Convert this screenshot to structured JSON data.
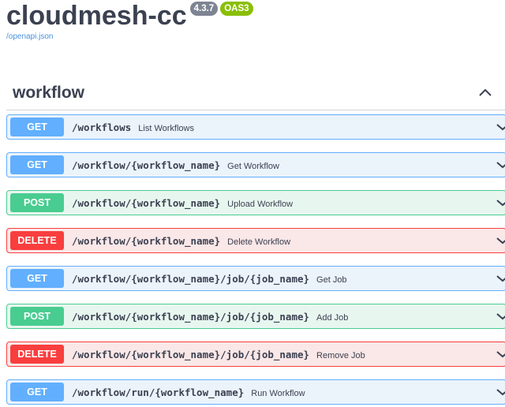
{
  "header": {
    "title": "cloudmesh-cc",
    "version_badge": "4.3.7",
    "oas_badge": "OAS3",
    "spec_link": "/openapi.json"
  },
  "colors": {
    "get": "#61affe",
    "post": "#49cc90",
    "delete": "#f93e3e",
    "version_badge": "#7d8492",
    "oas_badge": "#89bf04",
    "link": "#4990e2"
  },
  "tag": {
    "name": "workflow",
    "toggle_icon": "chevron-up-icon"
  },
  "operations": [
    {
      "method": "GET",
      "path": "/workflows",
      "summary": "List Workflows"
    },
    {
      "method": "GET",
      "path": "/workflow/{workflow_name}",
      "summary": "Get Workflow"
    },
    {
      "method": "POST",
      "path": "/workflow/{workflow_name}",
      "summary": "Upload Workflow"
    },
    {
      "method": "DELETE",
      "path": "/workflow/{workflow_name}",
      "summary": "Delete Workflow"
    },
    {
      "method": "GET",
      "path": "/workflow/{workflow_name}/job/{job_name}",
      "summary": "Get Job"
    },
    {
      "method": "POST",
      "path": "/workflow/{workflow_name}/job/{job_name}",
      "summary": "Add Job"
    },
    {
      "method": "DELETE",
      "path": "/workflow/{workflow_name}/job/{job_name}",
      "summary": "Remove Job"
    },
    {
      "method": "GET",
      "path": "/workflow/run/{workflow_name}",
      "summary": "Run Workflow"
    }
  ]
}
